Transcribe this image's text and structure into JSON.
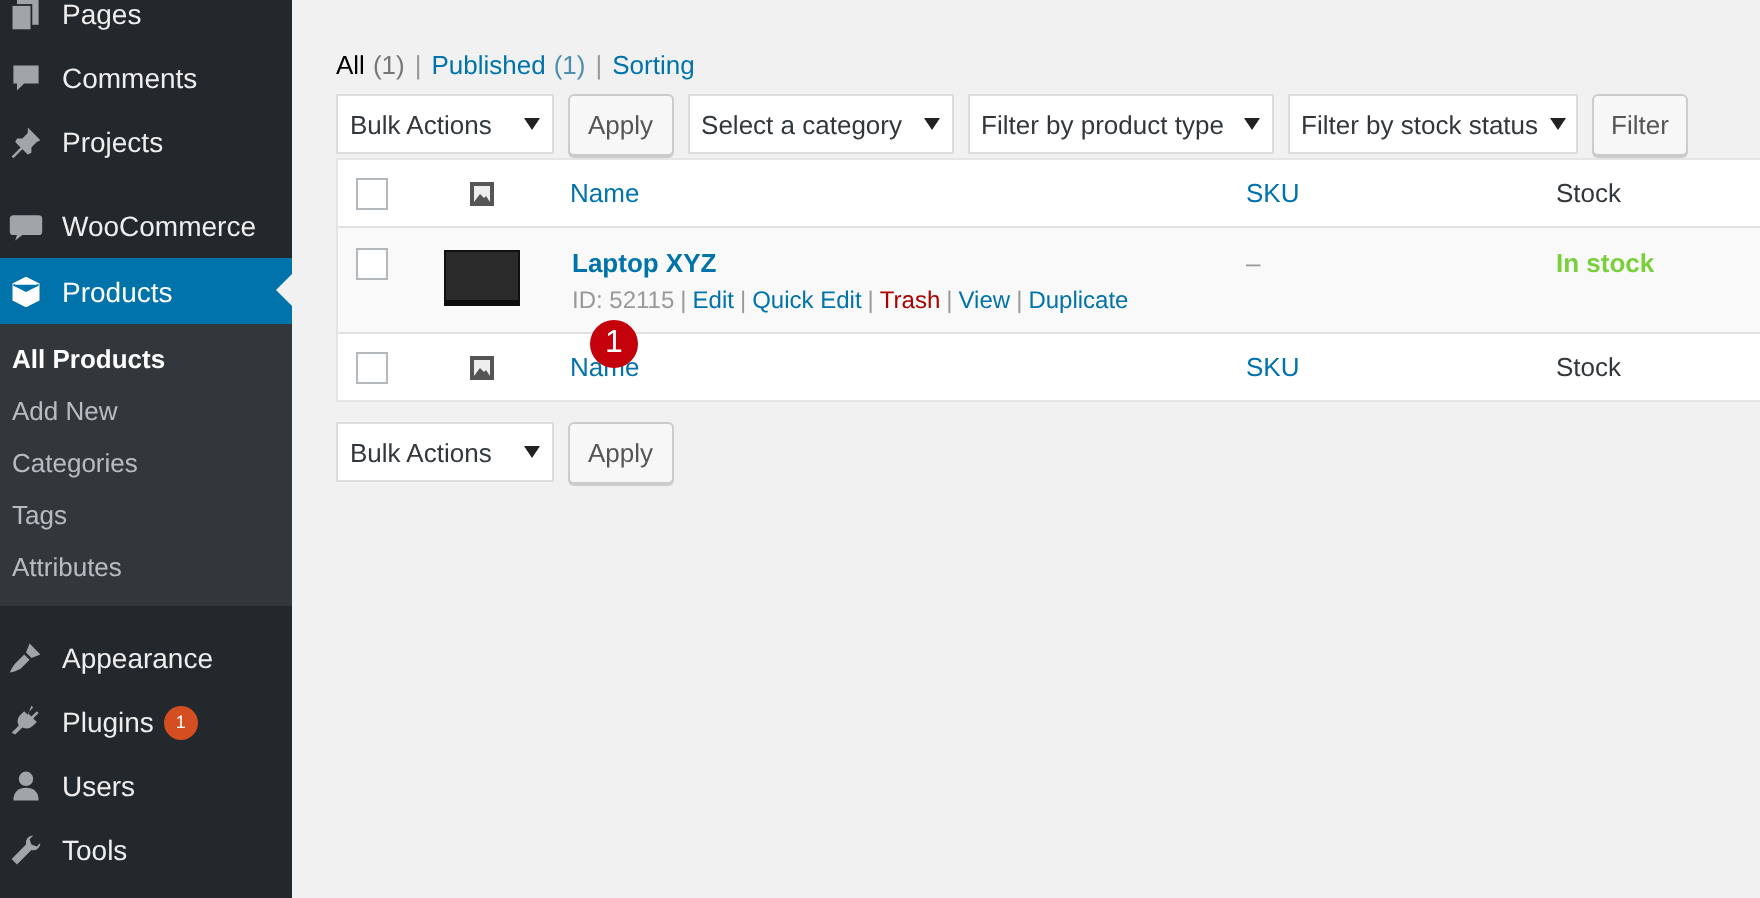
{
  "sidebar": {
    "groups": [
      {
        "items": [
          {
            "label": "Pages",
            "current": false
          },
          {
            "label": "Comments",
            "current": false
          },
          {
            "label": "Projects",
            "current": false
          }
        ]
      },
      {
        "items": [
          {
            "label": "WooCommerce",
            "current": false
          },
          {
            "label": "Products",
            "current": true,
            "submenu": [
              {
                "label": "All Products",
                "selected": true
              },
              {
                "label": "Add New",
                "selected": false
              },
              {
                "label": "Categories",
                "selected": false
              },
              {
                "label": "Tags",
                "selected": false
              },
              {
                "label": "Attributes",
                "selected": false
              }
            ]
          }
        ]
      },
      {
        "items": [
          {
            "label": "Appearance",
            "current": false
          },
          {
            "label": "Plugins",
            "current": false,
            "badge": "1"
          },
          {
            "label": "Users",
            "current": false
          },
          {
            "label": "Tools",
            "current": false
          }
        ]
      }
    ]
  },
  "views": {
    "separator": "|",
    "items": [
      {
        "label": "All",
        "count": "(1)",
        "selected": true
      },
      {
        "label": "Published",
        "count": "(1)",
        "selected": false
      },
      {
        "label": "Sorting",
        "selected": false
      }
    ]
  },
  "top_toolbar": {
    "bulk_actions": "Bulk Actions",
    "apply": "Apply",
    "filters": [
      "Select a category",
      "Filter by product type",
      "Filter by stock status"
    ],
    "filter_button": "Filter"
  },
  "table": {
    "columns": [
      "Name",
      "SKU",
      "Stock"
    ],
    "rows": [
      {
        "checked": false,
        "name": "Laptop XYZ",
        "id": "ID: 52115",
        "separator": "|",
        "actions": [
          {
            "label": "Edit",
            "kind": "link"
          },
          {
            "label": "Quick Edit",
            "kind": "link"
          },
          {
            "label": "Trash",
            "kind": "danger"
          },
          {
            "label": "View",
            "kind": "link"
          },
          {
            "label": "Duplicate",
            "kind": "link"
          }
        ],
        "sku": "–",
        "stock": "In stock",
        "in_stock": true
      }
    ],
    "header_checked": false,
    "footer_columns": [
      "Name",
      "SKU",
      "Stock"
    ],
    "footer_checked": false
  },
  "bottom_toolbar": {
    "bulk_actions": "Bulk Actions",
    "apply": "Apply"
  },
  "annotation_marker": "1"
}
